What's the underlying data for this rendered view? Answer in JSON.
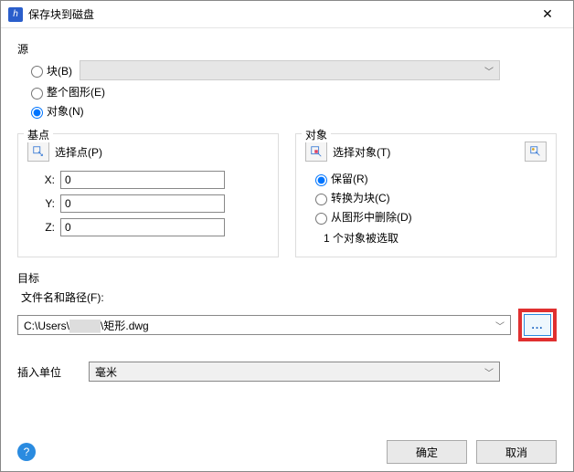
{
  "window": {
    "title": "保存块到磁盘"
  },
  "source": {
    "label": "源",
    "options": {
      "block": "块(B)",
      "whole": "整个图形(E)",
      "objects": "对象(N)"
    },
    "selected": "objects",
    "block_combo_placeholder": ""
  },
  "basepoint": {
    "legend": "基点",
    "pick_label": "选择点(P)",
    "x_label": "X:",
    "x": "0",
    "y_label": "Y:",
    "y": "0",
    "z_label": "Z:",
    "z": "0"
  },
  "objects": {
    "legend": "对象",
    "select_label": "选择对象(T)",
    "modes": {
      "retain": "保留(R)",
      "convert": "转换为块(C)",
      "delete": "从图形中删除(D)"
    },
    "selected_mode": "retain",
    "status": "1 个对象被选取"
  },
  "target": {
    "label": "目标",
    "path_label": "文件名和路径(F):",
    "path_prefix": "C:\\Users\\",
    "path_suffix": "\\矩形.dwg",
    "browse_label": "...",
    "units_label": "插入单位",
    "units_value": "毫米"
  },
  "buttons": {
    "ok": "确定",
    "cancel": "取消",
    "help": "?"
  }
}
